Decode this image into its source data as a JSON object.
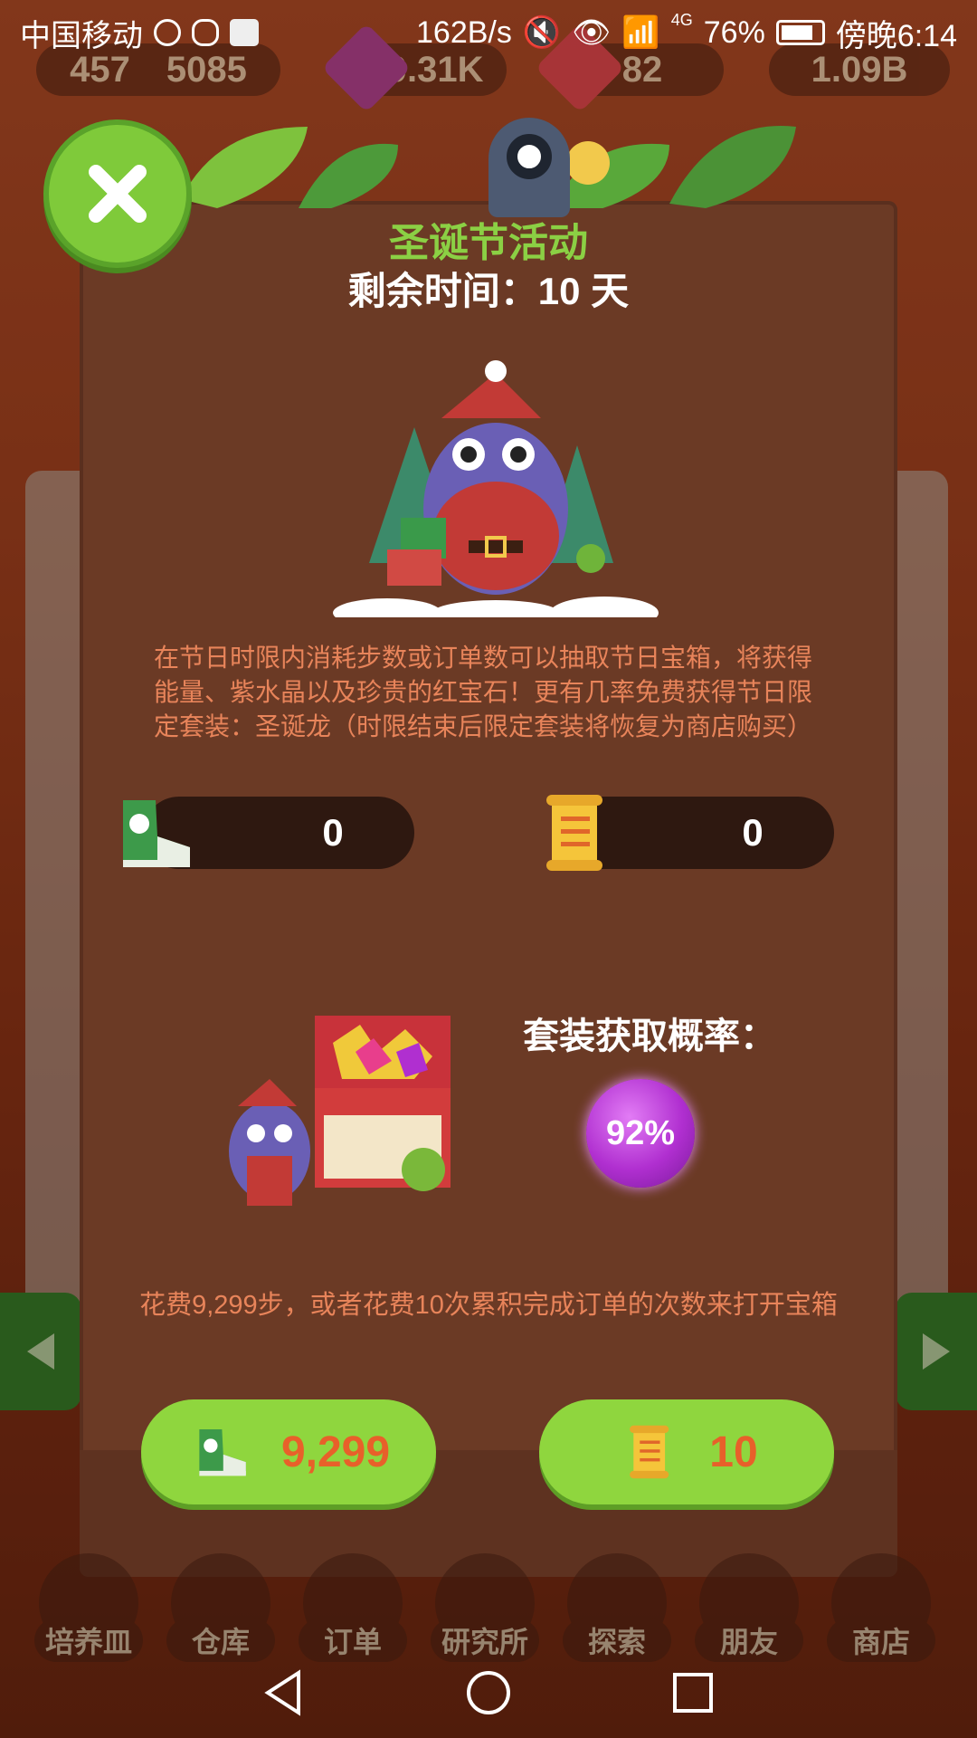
{
  "status_bar": {
    "carrier": "中国移动",
    "network_speed": "162B/s",
    "network_type": "4G",
    "battery": "76%",
    "time": "傍晚6:14"
  },
  "resources": {
    "level": "457",
    "coins": "5085",
    "crystals": "70.31K",
    "rubies": "82",
    "energy": "1.09B"
  },
  "dialog": {
    "title": "圣诞节活动",
    "subtitle": "剩余时间：10 天",
    "description": "在节日时限内消耗步数或订单数可以抽取节日宝箱，将获得能量、紫水晶以及珍贵的红宝石！更有几率免费获得节日限定套装：圣诞龙（时限结束后限定套装将恢复为商店购买）",
    "steps_count": "0",
    "orders_count": "0",
    "probability_label": "套装获取概率：",
    "probability_value": "92%",
    "cost_text": "花费9,299步，或者花费10次累积完成订单的次数来打开宝箱",
    "steps_button_label": "9,299",
    "orders_button_label": "10"
  },
  "tabs": [
    "培养皿",
    "仓库",
    "订单",
    "研究所",
    "探索",
    "朋友",
    "商店"
  ],
  "icons": {
    "close": "close-icon",
    "steps": "sneaker-icon",
    "orders": "scroll-icon"
  },
  "colors": {
    "dialog_bg": "#6b3a25",
    "title_green": "#8bd044",
    "text_orange": "#e8845a",
    "button_green": "#8fd63e",
    "orb_purple": "#b02fd0"
  }
}
